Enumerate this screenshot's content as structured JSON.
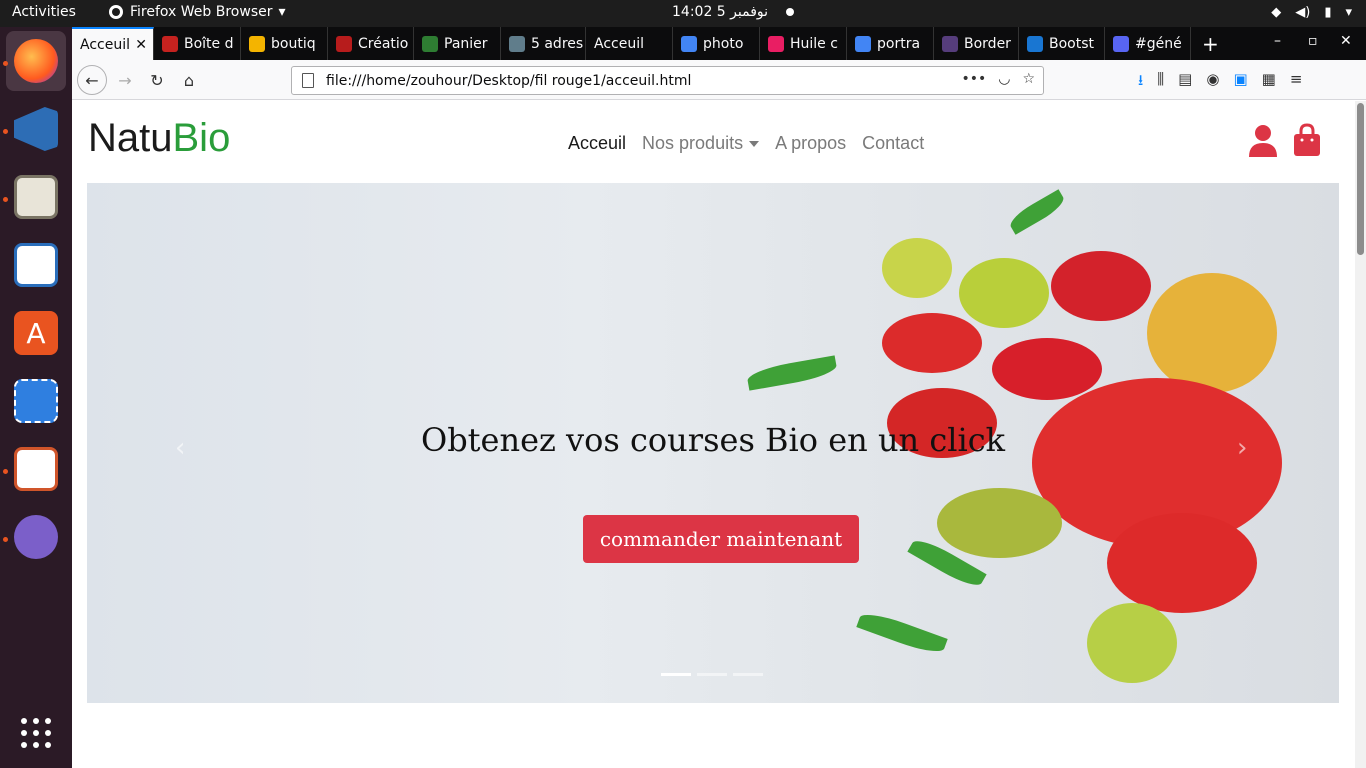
{
  "topbar": {
    "activities": "Activities",
    "app_name": "Firefox Web Browser",
    "clock": "14:02  5 نوفمبر"
  },
  "tabs": [
    {
      "label": "Acceuil",
      "color": "#f9f9fa"
    },
    {
      "label": "Boîte d",
      "color": "#c5221f"
    },
    {
      "label": "boutiq",
      "color": "#f4b400"
    },
    {
      "label": "Créatio",
      "color": "#b71c1c"
    },
    {
      "label": "Panier",
      "color": "#2e7d32"
    },
    {
      "label": "5 adres",
      "color": "#607d8b"
    },
    {
      "label": "Acceuil",
      "color": "#0c0c0d"
    },
    {
      "label": "photo",
      "color": "#4285f4"
    },
    {
      "label": "Huile c",
      "color": "#e91e63"
    },
    {
      "label": "portra",
      "color": "#4285f4"
    },
    {
      "label": "Border",
      "color": "#563d7c"
    },
    {
      "label": "Bootst",
      "color": "#1976d2"
    },
    {
      "label": "#géné",
      "color": "#5865f2"
    }
  ],
  "url": "file:///home/zouhour/Desktop/fil rouge1/acceuil.html",
  "site": {
    "brand_a": "Natu",
    "brand_b": "Bio",
    "nav": {
      "home": "Acceuil",
      "products": "Nos produits",
      "about": "A propos",
      "contact": "Contact"
    },
    "hero": {
      "headline": "Obtenez vos courses Bio en un click",
      "cta": "commander maintenant",
      "active_slide": 1,
      "slide_count": 3
    },
    "accent": "#dc3545",
    "brand_green": "#2a9d3a"
  }
}
